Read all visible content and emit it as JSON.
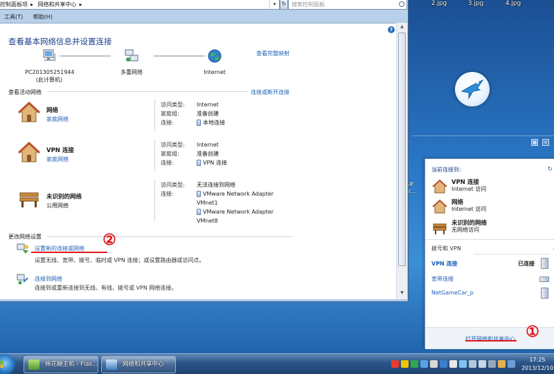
{
  "desktop": {
    "files": [
      "2.jpg",
      "3.jpg",
      "4.jpg"
    ],
    "gif_label": "GIF",
    "gif_sub": "ar..."
  },
  "window": {
    "address": [
      "控制面板项",
      "网络和共享中心"
    ],
    "search_placeholder": "搜索控制面板",
    "menu": [
      "工具(T)",
      "帮助(H)"
    ],
    "title": "查看基本网络信息并设置连接",
    "map": {
      "computer": "PC201305251944",
      "computer_sub": "(此计算机)",
      "middle": "多重网络",
      "internet": "Internet",
      "full_map_link": "查看完整映射"
    },
    "active_networks": {
      "heading": "查看活动网络",
      "connect_link": "连接或断开连接",
      "rows": [
        {
          "name": "网络",
          "type": "家庭网络",
          "access_label": "访问类型:",
          "access_value": "Internet",
          "homegroup_label": "家庭组:",
          "homegroup_value": "准备创建",
          "conn_label": "连接:",
          "conn_values": [
            "本地连接"
          ]
        },
        {
          "name": "VPN 连接",
          "type": "家庭网络",
          "access_label": "访问类型:",
          "access_value": "Internet",
          "homegroup_label": "家庭组:",
          "homegroup_value": "准备创建",
          "conn_label": "连接:",
          "conn_values": [
            "VPN 连接"
          ]
        },
        {
          "name": "未识别的网络",
          "type": "公用网络",
          "access_label": "访问类型:",
          "access_value": "无法连接到网络",
          "conn_label": "连接:",
          "conn_values": [
            "VMware Network Adapter",
            "VMnet1",
            "VMware Network Adapter",
            "VMnet8"
          ]
        }
      ]
    },
    "change_settings": {
      "heading": "更改网络设置",
      "tasks": [
        {
          "link": "设置新的连接或网络",
          "desc": "设置无线、宽带、拨号、临时或 VPN 连接；或设置路由器或访问点。"
        },
        {
          "link": "连接到网络",
          "desc": "连接到或重新连接到无线、有线、拨号或 VPN 网络连接。"
        }
      ]
    },
    "annotation_2": "②"
  },
  "popup": {
    "heading": "当前连接到:",
    "networks": [
      {
        "name": "VPN 连接",
        "status": "Internet 访问"
      },
      {
        "name": "网络",
        "status": "Internet 访问"
      },
      {
        "name": "未识别的网络",
        "status": "无网络访问"
      }
    ],
    "vpn_heading": "拨号和 VPN",
    "vpn_items": [
      {
        "name": "VPN 连接",
        "status": "已连接"
      },
      {
        "name": "宽带连接",
        "status": ""
      },
      {
        "name": "NetGameCar_p",
        "status": ""
      }
    ],
    "footer_link": "打开网络和共享中心",
    "annotation_1": "①"
  },
  "taskbar": {
    "buttons": [
      "棉花糖主机 - Flas...",
      "网络和共享中心"
    ],
    "clock_time": "17:25",
    "clock_date": "2013/12/10"
  },
  "colors": {
    "link": "#1d5fb5",
    "title": "#1d3f8c",
    "annotation": "#e0141a"
  }
}
